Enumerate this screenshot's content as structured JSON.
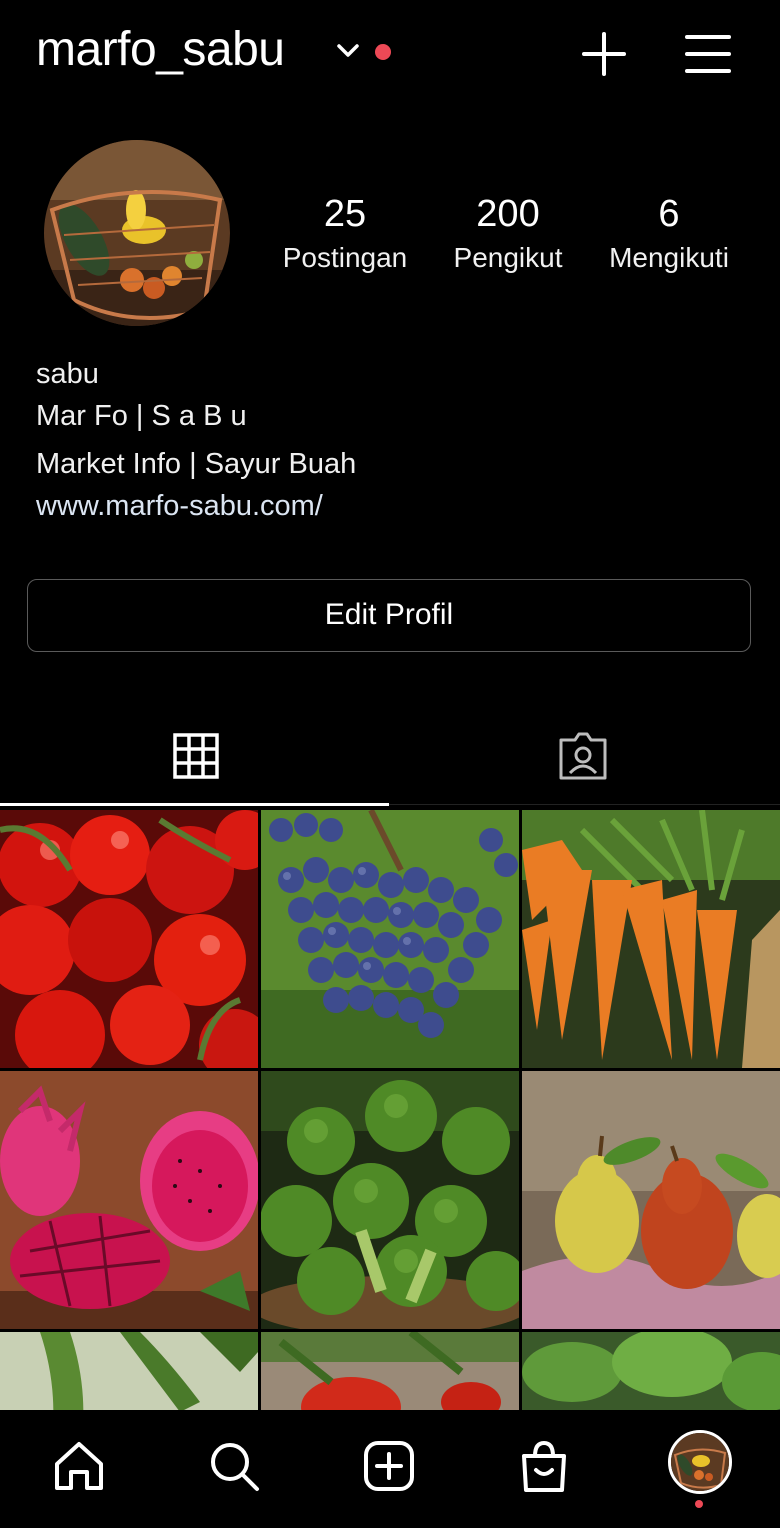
{
  "header": {
    "username": "marfo_sabu",
    "icons": [
      "chevron-down-icon",
      "notification-dot",
      "plus-icon",
      "menu-icon"
    ],
    "notification_color": "#ed4956"
  },
  "profile": {
    "stats": [
      {
        "value": "25",
        "label": "Postingan"
      },
      {
        "value": "200",
        "label": "Pengikut"
      },
      {
        "value": "6",
        "label": "Mengikuti"
      }
    ],
    "bio": {
      "name": "sabu",
      "line1": "Mar Fo | S a B u",
      "line2": "Market Info | Sayur Buah",
      "website": "www.marfo-sabu.com/"
    },
    "edit_button": "Edit Profil"
  },
  "tabs": [
    {
      "icon": "grid-icon",
      "active": true
    },
    {
      "icon": "tagged-icon",
      "active": false
    }
  ],
  "posts": [
    {
      "subject": "tomatoes"
    },
    {
      "subject": "grapes"
    },
    {
      "subject": "carrots"
    },
    {
      "subject": "dragon fruit"
    },
    {
      "subject": "broccoli"
    },
    {
      "subject": "pears"
    },
    {
      "subject": "cucumbers"
    },
    {
      "subject": "apples"
    },
    {
      "subject": "leafy greens"
    }
  ],
  "bottom_nav": [
    "home-icon",
    "search-icon",
    "create-icon",
    "shop-icon",
    "profile-avatar"
  ]
}
